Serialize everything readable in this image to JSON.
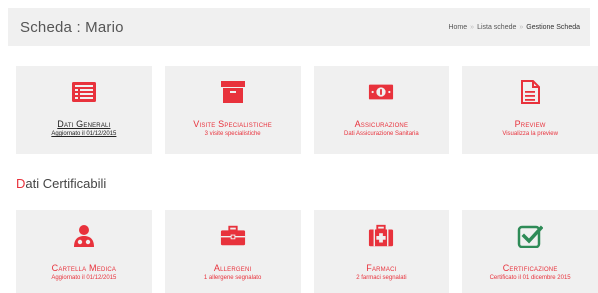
{
  "header": {
    "title": "Scheda : Mario",
    "breadcrumb": {
      "home": "Home",
      "separator": "»",
      "list": "Lista schede",
      "current": "Gestione Scheda"
    }
  },
  "section": {
    "first_letter": "D",
    "rest": "ati Certificabili"
  },
  "row1": [
    {
      "title": "Dati Generali",
      "subtitle": "Aggiornato il 01/12/2015",
      "icon": "list-card-icon"
    },
    {
      "title": "Visite Specialistiche",
      "subtitle": "3 visite specialistiche",
      "icon": "archive-box-icon"
    },
    {
      "title": "Assicurazione",
      "subtitle": "Dati Assicurazione Sanitaria",
      "icon": "banknote-icon"
    },
    {
      "title": "Preview",
      "subtitle": "Visualizza la preview",
      "icon": "document-icon"
    }
  ],
  "row2": [
    {
      "title": "Cartella Medica",
      "subtitle": "Aggiornato il 01/12/2015",
      "icon": "doctor-icon"
    },
    {
      "title": "Allergeni",
      "subtitle": "1 allergene segnalato",
      "icon": "briefcase-icon"
    },
    {
      "title": "Farmaci",
      "subtitle": "2 farmaci segnalati",
      "icon": "medkit-icon"
    },
    {
      "title": "Certificazione",
      "subtitle": "Certificato il 01 dicembre 2015",
      "icon": "check-square-icon"
    }
  ],
  "colors": {
    "accent": "#e8323c",
    "green": "#2e8b57",
    "card_bg": "#f0f0f0"
  }
}
